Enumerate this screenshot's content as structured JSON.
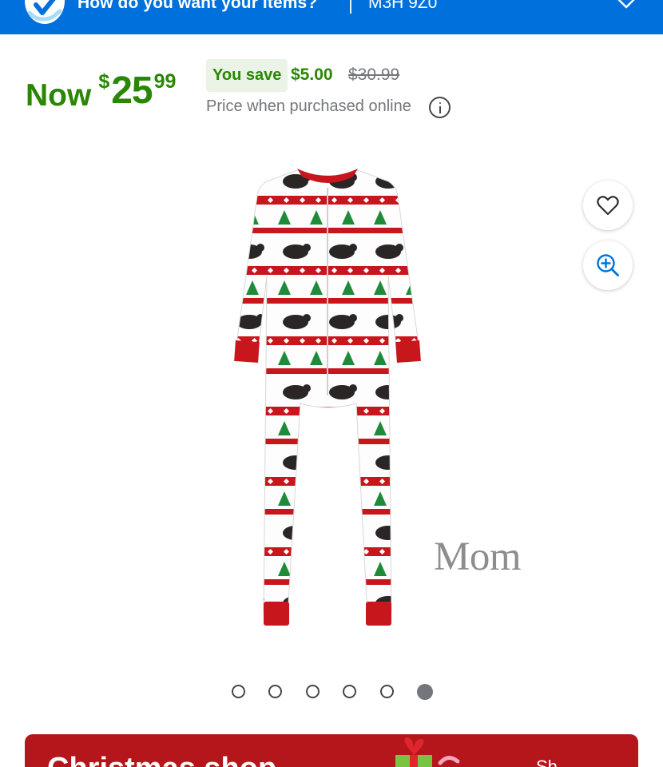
{
  "header": {
    "question": "How do you want your items?",
    "postal_code": "M3H 9Z0",
    "chevron_icon": "chevron-down-icon",
    "brand_color": "#0071dc"
  },
  "price": {
    "now_label": "Now",
    "currency_symbol": "$",
    "dollars": "25",
    "cents": "99",
    "you_save_label": "You save",
    "save_amount": "$5.00",
    "was_price": "$30.99",
    "note": "Price when purchased online",
    "green_color": "#2a8703"
  },
  "gallery": {
    "image_caption": "Mom",
    "favorite_icon": "heart-icon",
    "zoom_icon": "zoom-in-icon",
    "dot_count": 6,
    "active_index": 5
  },
  "banner": {
    "title": "Christmas shop",
    "link_text": "Sh",
    "color": "#b5161b"
  }
}
